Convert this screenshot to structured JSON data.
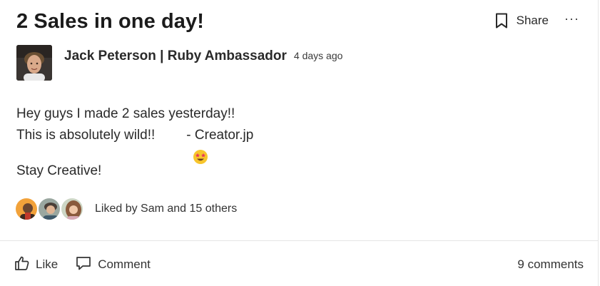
{
  "post": {
    "title": "2 Sales in one day!",
    "share_label": "Share",
    "more_label": "···",
    "author": {
      "name": "Jack Peterson | Ruby Ambassador",
      "time": "4 days ago"
    },
    "body": {
      "line1": "Hey guys I made 2 sales yesterday!!",
      "line2_before": "This is absolutely wild!!",
      "line2_emoji": "star-struck-emoji",
      "line2_after": "- Creator.jp",
      "line3": "Stay Creative!"
    },
    "likes": {
      "text": "Liked by Sam and 15 others",
      "avatars": [
        "avatar-1",
        "avatar-2",
        "avatar-3"
      ]
    }
  },
  "footer": {
    "like_label": "Like",
    "comment_label": "Comment",
    "comments_count": "9 comments"
  },
  "colors": {
    "text": "#2a2a2a",
    "divider": "#e4e4e4",
    "emoji": "#f7c52c"
  }
}
